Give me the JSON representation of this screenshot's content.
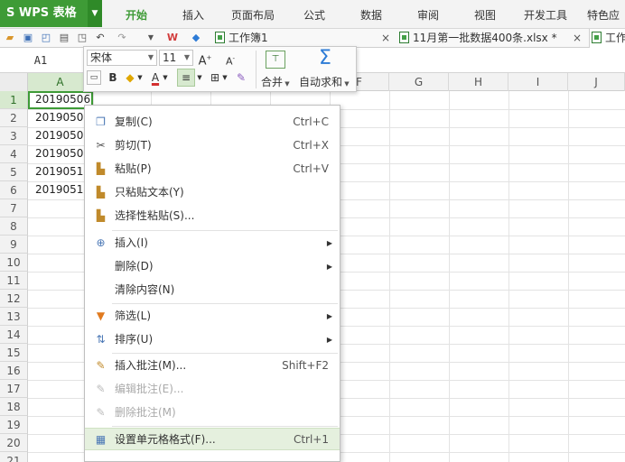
{
  "app": {
    "logo_text": "S WPS 表格",
    "menu_tabs": [
      "开始",
      "插入",
      "页面布局",
      "公式",
      "数据",
      "审阅",
      "视图",
      "开发工具",
      "特色应用"
    ],
    "active_tab": "开始",
    "brand_color": "#3e9b36"
  },
  "document_tabs": [
    {
      "label": "工作簿1",
      "close": "×"
    },
    {
      "label": "11月第一批数据400条.xlsx *",
      "close": "×"
    },
    {
      "label": "工作"
    }
  ],
  "name_box": "A1",
  "columns": [
    "A",
    "B",
    "C",
    "D",
    "E",
    "F",
    "G",
    "H",
    "I",
    "J"
  ],
  "rows": [
    "1",
    "2",
    "3",
    "4",
    "5",
    "6",
    "7",
    "8",
    "9",
    "10",
    "11",
    "12",
    "13",
    "14",
    "15",
    "16",
    "17",
    "18",
    "19",
    "20",
    "21"
  ],
  "cells": [
    "20190506",
    "2019050",
    "2019050",
    "2019050",
    "2019051",
    "2019051"
  ],
  "mini_toolbar": {
    "font_name": "宋体",
    "font_size": "11",
    "grow_font": "A",
    "shrink_font": "A",
    "bold": "B",
    "font_color": "A",
    "merge_label": "合并",
    "autosum_label": "自动求和"
  },
  "context_menu": {
    "items": [
      {
        "icon": "copy-icon",
        "label": "复制(C)",
        "shortcut": "Ctrl+C"
      },
      {
        "icon": "cut-icon",
        "label": "剪切(T)",
        "shortcut": "Ctrl+X"
      },
      {
        "icon": "paste-icon",
        "label": "粘贴(P)",
        "shortcut": "Ctrl+V"
      },
      {
        "icon": "paste-text-icon",
        "label": "只粘贴文本(Y)",
        "shortcut": ""
      },
      {
        "icon": "paste-special-icon",
        "label": "选择性粘贴(S)...",
        "shortcut": ""
      },
      {
        "icon": "insert-icon",
        "label": "插入(I)",
        "shortcut": ""
      },
      {
        "icon": "",
        "label": "删除(D)",
        "shortcut": ""
      },
      {
        "icon": "",
        "label": "清除内容(N)",
        "shortcut": ""
      },
      {
        "icon": "filter-icon",
        "label": "筛选(L)",
        "shortcut": ""
      },
      {
        "icon": "sort-icon",
        "label": "排序(U)",
        "shortcut": ""
      },
      {
        "icon": "comment-icon",
        "label": "插入批注(M)...",
        "shortcut": "Shift+F2"
      },
      {
        "icon": "edit-comment-icon",
        "label": "编辑批注(E)...",
        "shortcut": ""
      },
      {
        "icon": "delete-comment-icon",
        "label": "删除批注(M)",
        "shortcut": ""
      },
      {
        "icon": "format-cells-icon",
        "label": "设置单元格格式(F)...",
        "shortcut": "Ctrl+1"
      }
    ],
    "highlight_color": "#e5f0de"
  }
}
